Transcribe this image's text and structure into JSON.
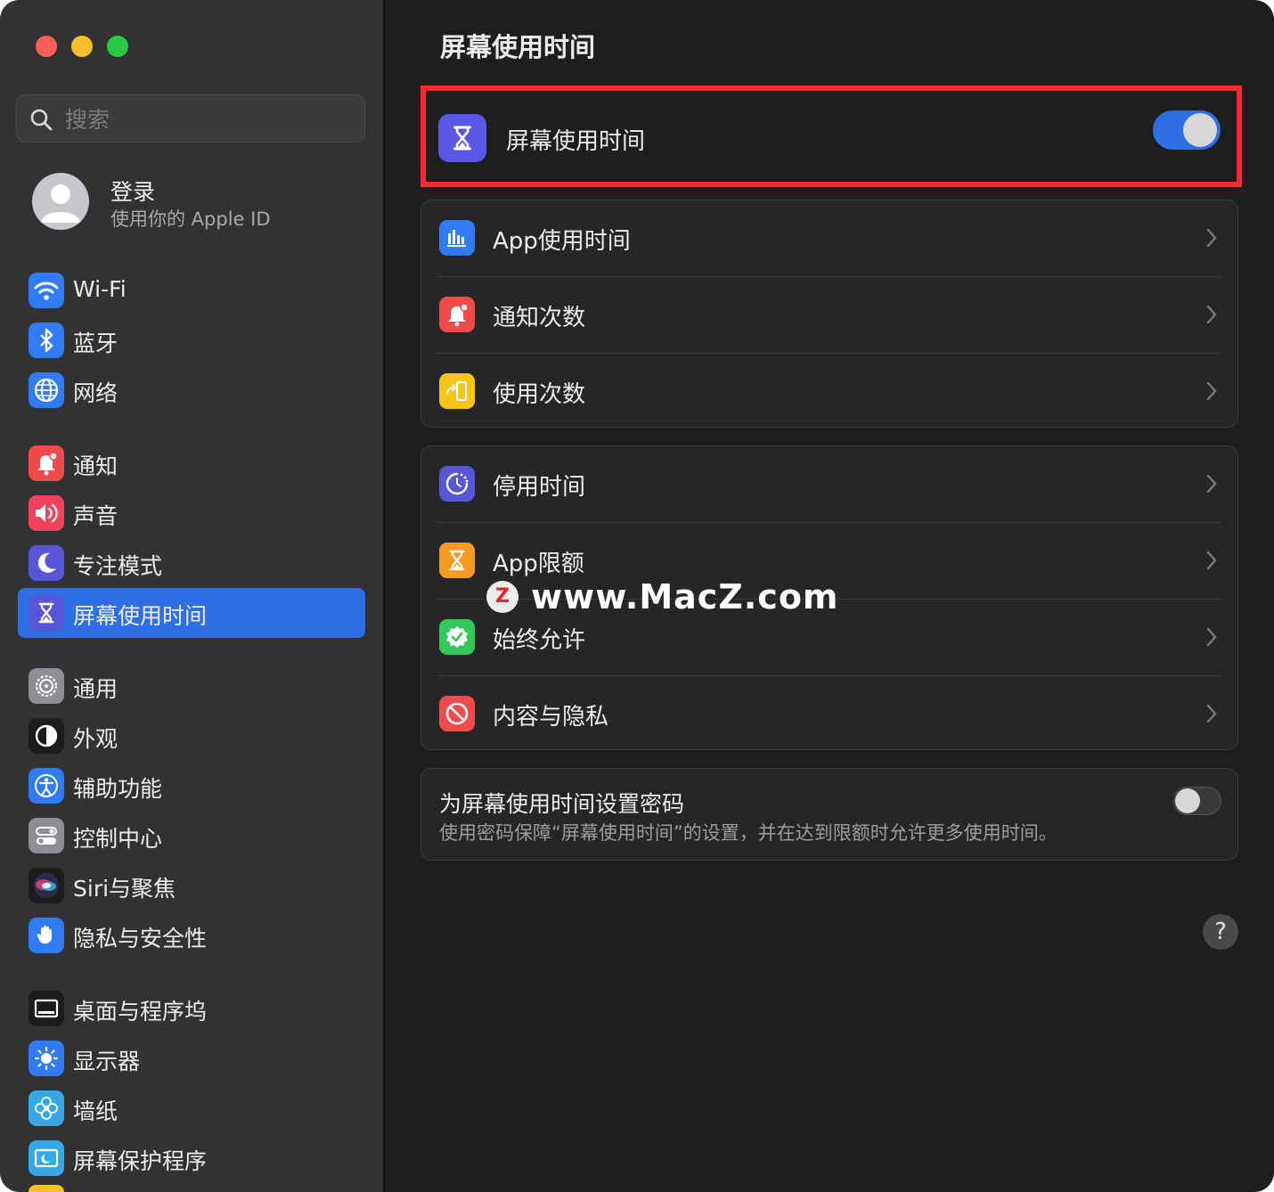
{
  "window": {
    "title": "屏幕使用时间"
  },
  "sidebar": {
    "search": {
      "placeholder": "搜索",
      "value": ""
    },
    "account": {
      "title": "登录",
      "subtitle": "使用你的 Apple ID"
    },
    "items": [
      {
        "label": "Wi-Fi",
        "icon": "wifi-icon",
        "color": "#2f7cf6"
      },
      {
        "label": "蓝牙",
        "icon": "bluetooth-icon",
        "color": "#2f7cf6"
      },
      {
        "label": "网络",
        "icon": "globe-icon",
        "color": "#2f7cf6"
      },
      {
        "label": "通知",
        "icon": "bell-icon",
        "color": "#f04b4b"
      },
      {
        "label": "声音",
        "icon": "speaker-icon",
        "color": "#f0425f"
      },
      {
        "label": "专注模式",
        "icon": "moon-icon",
        "color": "#5856d6"
      },
      {
        "label": "屏幕使用时间",
        "icon": "hourglass-icon",
        "color": "#5856d6",
        "selected": true
      },
      {
        "label": "通用",
        "icon": "gear-icon",
        "color": "#8e8e93"
      },
      {
        "label": "外观",
        "icon": "appearance-icon",
        "color": "#1c1c1e"
      },
      {
        "label": "辅助功能",
        "icon": "accessibility-icon",
        "color": "#2f7cf6"
      },
      {
        "label": "控制中心",
        "icon": "control-center-icon",
        "color": "#8e8e93"
      },
      {
        "label": "Siri与聚焦",
        "icon": "siri-icon",
        "color": "#1c1c1e"
      },
      {
        "label": "隐私与安全性",
        "icon": "hand-icon",
        "color": "#2f7cf6"
      },
      {
        "label": "桌面与程序坞",
        "icon": "dock-icon",
        "color": "#1c1c1e"
      },
      {
        "label": "显示器",
        "icon": "sun-icon",
        "color": "#2f7cf6"
      },
      {
        "label": "墙纸",
        "icon": "flower-icon",
        "color": "#35a8e6"
      },
      {
        "label": "屏幕保护程序",
        "icon": "screensaver-icon",
        "color": "#35a8e6"
      }
    ]
  },
  "main": {
    "title": "屏幕使用时间",
    "screen_time": {
      "label": "屏幕使用时间",
      "enabled": true
    },
    "group1": [
      {
        "label": "App使用时间",
        "icon": "chart-bars-icon",
        "color": "#2f7cf6"
      },
      {
        "label": "通知次数",
        "icon": "bell-icon",
        "color": "#f04b4b"
      },
      {
        "label": "使用次数",
        "icon": "pickup-icon",
        "color": "#f5c518"
      }
    ],
    "group2": [
      {
        "label": "停用时间",
        "icon": "downtime-icon",
        "color": "#5856d6"
      },
      {
        "label": "App限额",
        "icon": "hourglass-icon",
        "color": "#f59a23"
      },
      {
        "label": "始终允许",
        "icon": "checkmark-badge-icon",
        "color": "#34c759"
      },
      {
        "label": "内容与隐私",
        "icon": "restricted-icon",
        "color": "#f04b4b"
      }
    ],
    "passcode": {
      "title": "为屏幕使用时间设置密码",
      "description": "使用密码保障“屏幕使用时间”的设置，并在达到限额时允许更多使用时间。",
      "enabled": false
    },
    "help_label": "?"
  },
  "watermark": {
    "logo": "Z",
    "text": "www.MacZ.com"
  }
}
